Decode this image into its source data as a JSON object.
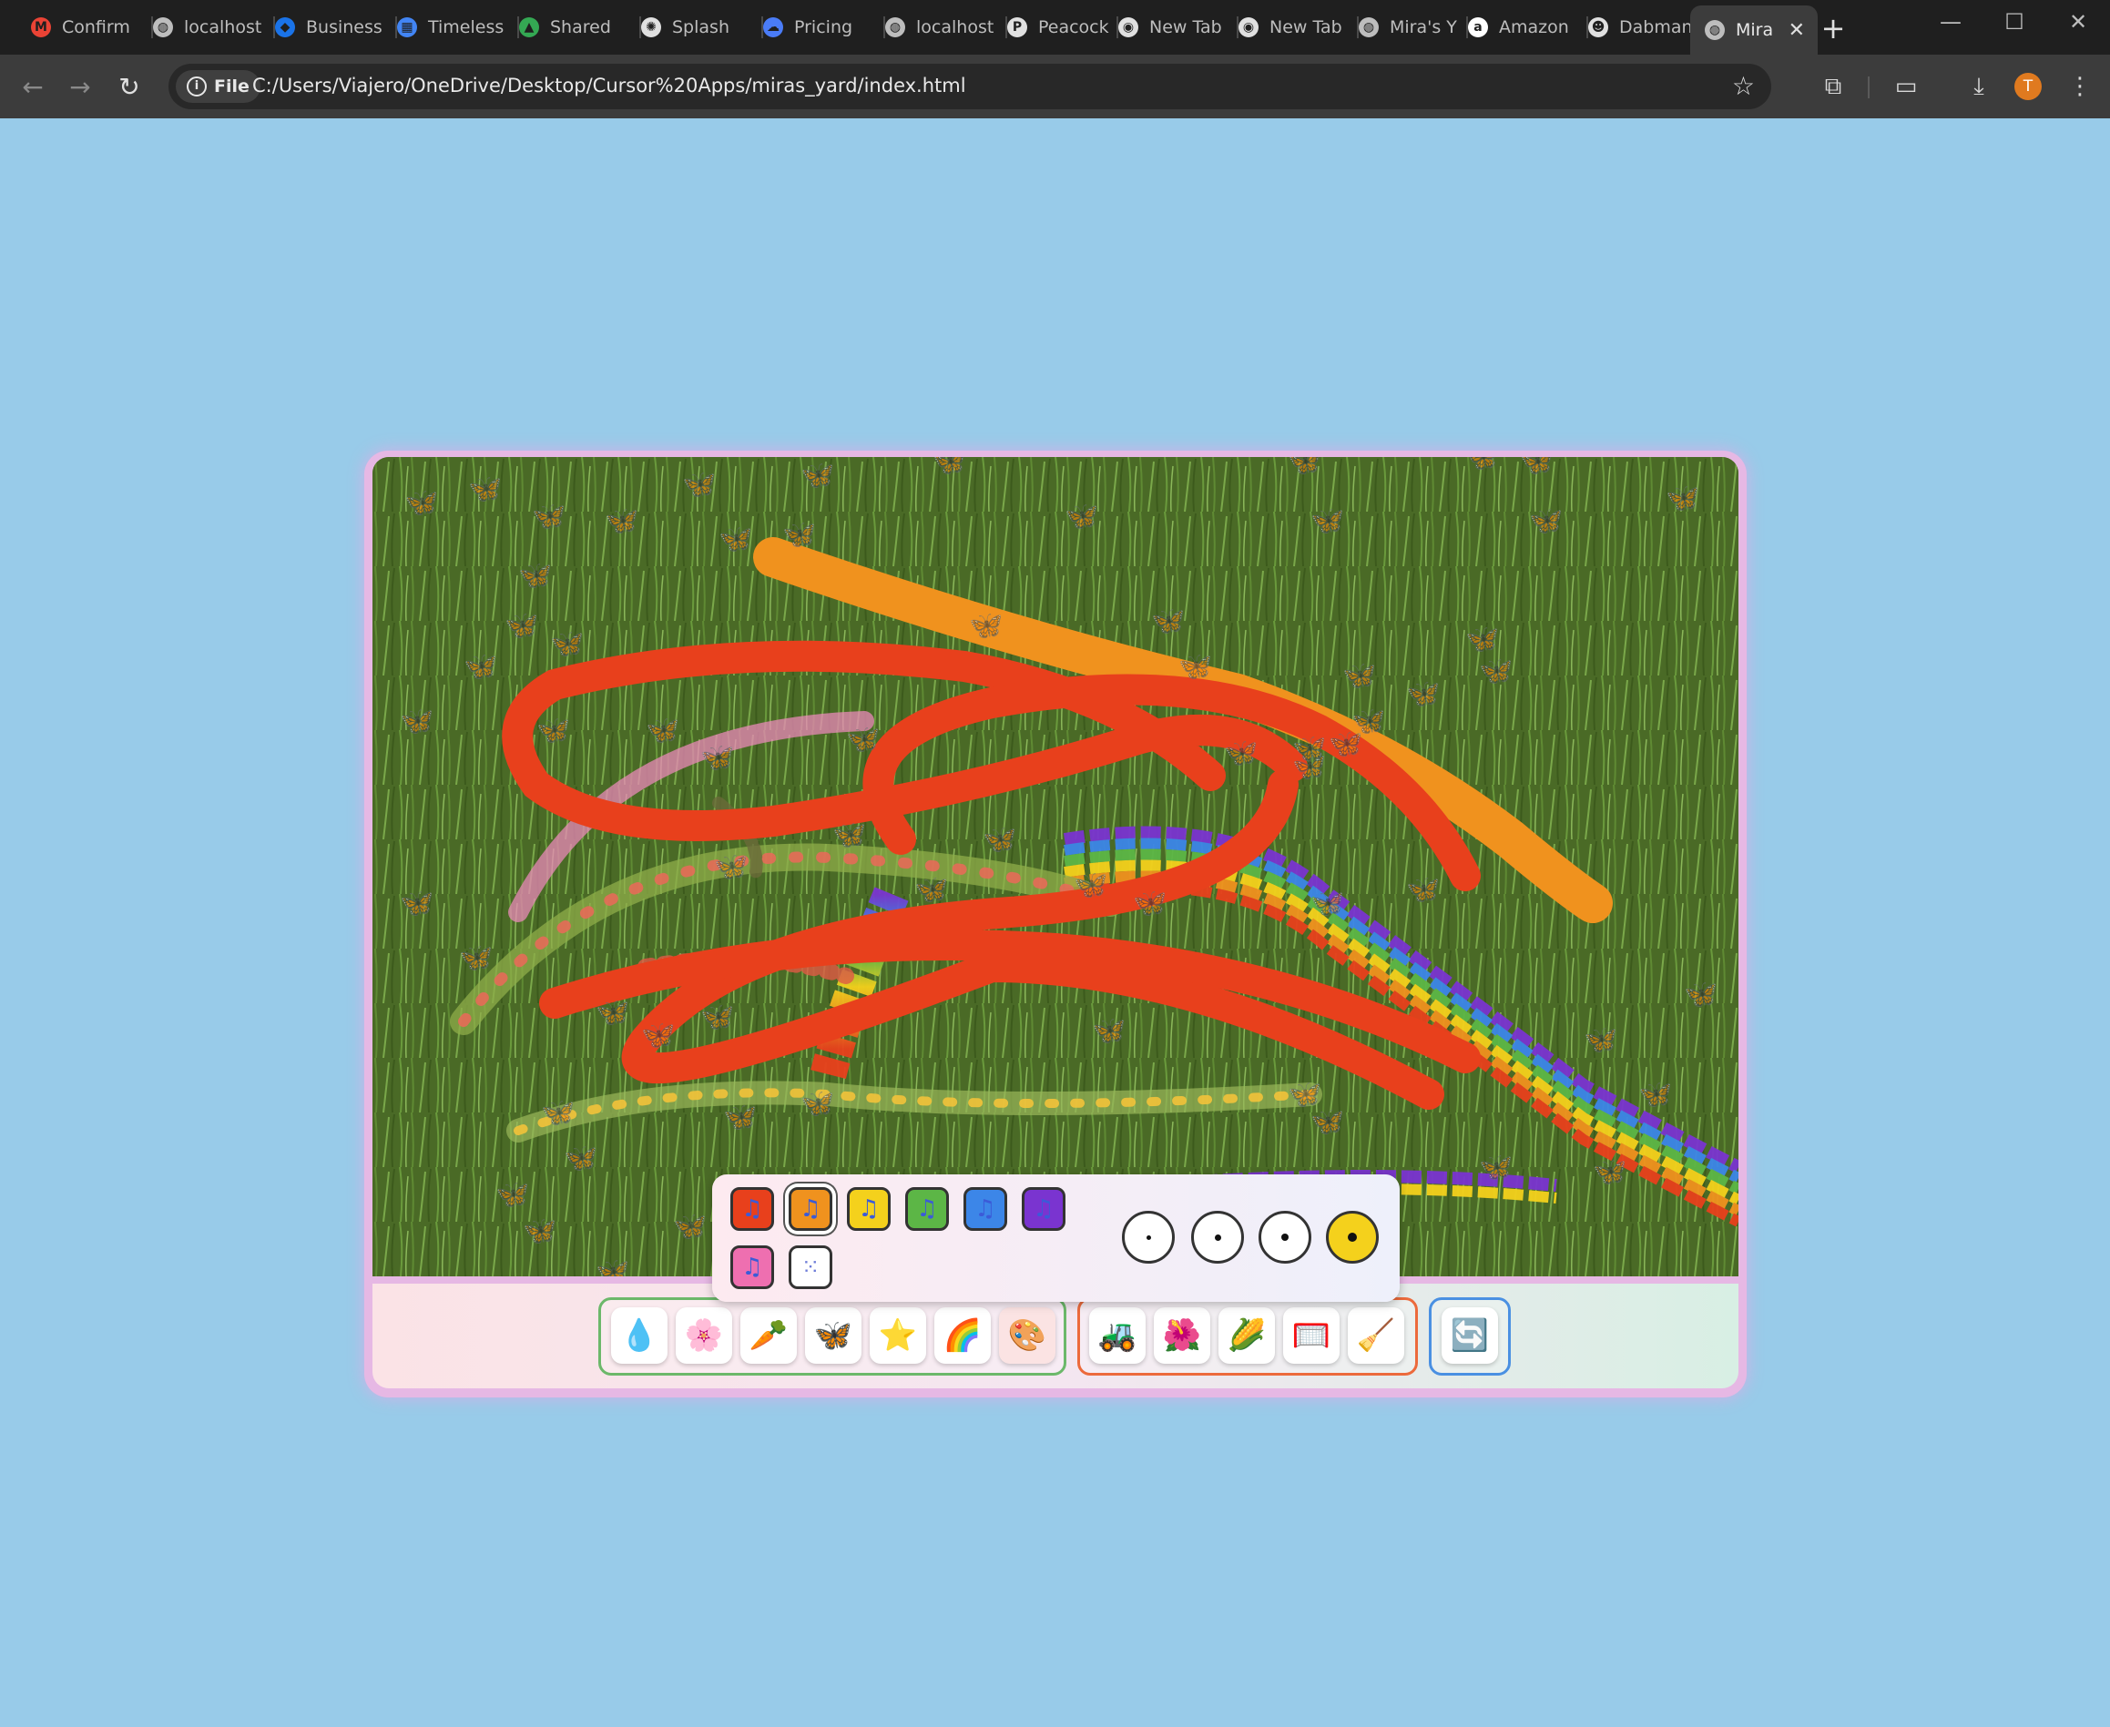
{
  "tabs": [
    {
      "title": "Confirm",
      "icon": "gmail-icon",
      "color": "#ea4335"
    },
    {
      "title": "localhost",
      "icon": "globe-icon",
      "color": "#bdbdbd"
    },
    {
      "title": "Business",
      "icon": "chase-icon",
      "color": "#1a73e8"
    },
    {
      "title": "Timeless",
      "icon": "calendar-icon",
      "color": "#4285f4"
    },
    {
      "title": "Shared",
      "icon": "drive-icon",
      "color": "#34a853"
    },
    {
      "title": "Splash",
      "icon": "openai-icon",
      "color": "#e0e0e0"
    },
    {
      "title": "Pricing",
      "icon": "cloud-icon",
      "color": "#4a7cf7"
    },
    {
      "title": "localhost",
      "icon": "globe-icon",
      "color": "#bdbdbd"
    },
    {
      "title": "Peacock",
      "icon": "peacock-icon",
      "color": "#e0e0e0"
    },
    {
      "title": "New Tab",
      "icon": "chrome-icon",
      "color": "#e0e0e0"
    },
    {
      "title": "New Tab",
      "icon": "chrome-icon",
      "color": "#e0e0e0"
    },
    {
      "title": "Mira's Y",
      "icon": "globe-icon",
      "color": "#bdbdbd"
    },
    {
      "title": "Amazon",
      "icon": "amazon-icon",
      "color": "#ffffff"
    },
    {
      "title": "Dabman",
      "icon": "dabman-icon",
      "color": "#e0e0e0"
    },
    {
      "title": "Mira",
      "icon": "globe-icon",
      "color": "#bdbdbd",
      "active": true
    }
  ],
  "address_bar": {
    "chip_label": "File",
    "url": "C:/Users/Viajero/OneDrive/Desktop/Cursor%20Apps/miras_yard/index.html"
  },
  "profile_initial": "T",
  "colors": {
    "sky": "#98cbe9",
    "grass": "#4a6a26",
    "accent_frame": "#e6b8e4"
  },
  "palette": {
    "colors": [
      {
        "name": "red",
        "hex": "#e8401c"
      },
      {
        "name": "orange",
        "hex": "#f0921e",
        "selected": true
      },
      {
        "name": "yellow",
        "hex": "#f4d11c"
      },
      {
        "name": "green",
        "hex": "#5cb646"
      },
      {
        "name": "blue",
        "hex": "#3c86e8"
      },
      {
        "name": "purple",
        "hex": "#7a34d0"
      },
      {
        "name": "pink",
        "hex": "#ee6fb0"
      },
      {
        "name": "rainbow-dots",
        "hex": "#ffffff"
      }
    ],
    "swatch_icon": "music-note-icon",
    "brush_sizes": [
      "small",
      "medium",
      "large",
      "x-large"
    ],
    "selected_size": "x-large"
  },
  "tool_groups": [
    {
      "name": "stamps",
      "border": "#6cb86a",
      "tools": [
        {
          "name": "water-drop",
          "glyph": "💧"
        },
        {
          "name": "flower",
          "glyph": "🌸"
        },
        {
          "name": "carrot",
          "glyph": "🥕"
        },
        {
          "name": "butterfly",
          "glyph": "🦋"
        },
        {
          "name": "star",
          "glyph": "⭐"
        },
        {
          "name": "rainbow",
          "glyph": "🌈"
        },
        {
          "name": "paint-palette",
          "glyph": "🎨",
          "selected": true
        }
      ]
    },
    {
      "name": "yard-tools",
      "border": "#ec6a3c",
      "tools": [
        {
          "name": "lawn-mower",
          "glyph": "🚜"
        },
        {
          "name": "hibiscus",
          "glyph": "🌺"
        },
        {
          "name": "corn",
          "glyph": "🌽"
        },
        {
          "name": "fence",
          "glyph": "🥅"
        },
        {
          "name": "broom",
          "glyph": "🧹"
        }
      ]
    },
    {
      "name": "reset",
      "border": "#4a90e2",
      "tools": [
        {
          "name": "refresh",
          "glyph": "🔄"
        }
      ]
    }
  ]
}
